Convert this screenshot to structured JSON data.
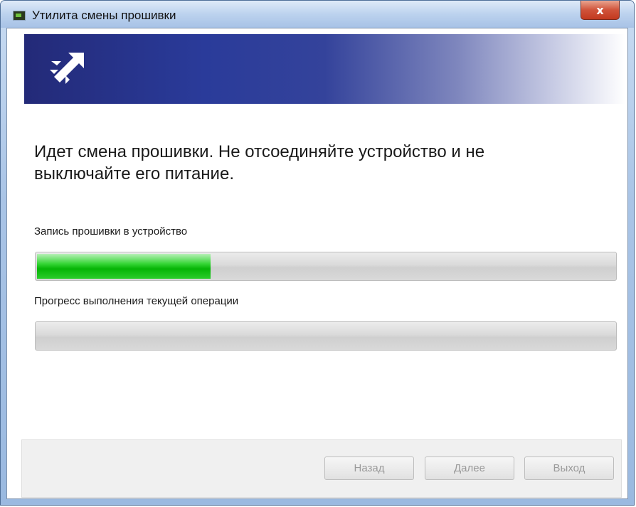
{
  "window": {
    "title": "Утилита смены прошивки",
    "close_label": "x"
  },
  "banner": {
    "logo_icon": "arrow-logo-icon",
    "colors": {
      "dark": "#232a78",
      "light": "#ffffff"
    }
  },
  "main": {
    "heading": "Идет смена прошивки. Не отсоединяйте устройство и не выключайте его питание.",
    "progress1": {
      "label": "Запись прошивки в устройство",
      "value": 0.3,
      "color": "#16c016"
    },
    "progress2": {
      "label": "Прогресс выполнения текущей операции",
      "value": 0
    }
  },
  "footer": {
    "back_label": "Назад",
    "next_label": "Далее",
    "exit_label": "Выход",
    "buttons_enabled": false
  }
}
